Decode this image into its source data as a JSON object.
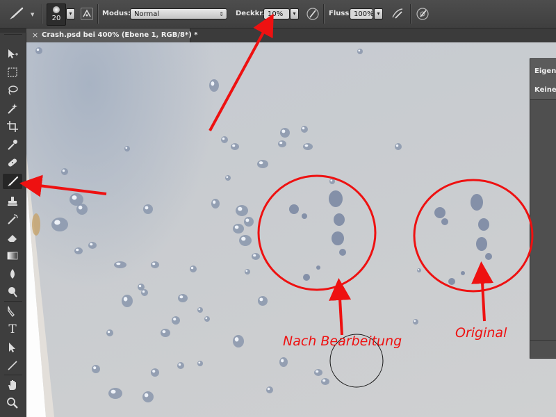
{
  "options_bar": {
    "brush_size": "20",
    "mode_label": "Modus:",
    "mode_value": "Normal",
    "opacity_label": "Deckkr.:",
    "opacity_value": "10%",
    "flow_label": "Fluss:",
    "flow_value": "100%"
  },
  "document_tab": {
    "close_glyph": "×",
    "title": "Crash.psd bei 400% (Ebene 1, RGB/8*) *"
  },
  "properties_panel": {
    "title": "Eigens",
    "content": "Keine"
  },
  "annotations": {
    "after_label": "Nach Bearbeitung",
    "original_label": "Original"
  },
  "colors": {
    "annotation_red": "#ee1111",
    "ui_dark": "#3e3e3e",
    "canvas_gray": "#c9ccd0"
  },
  "tools": [
    "move-tool-icon",
    "marquee-tool-icon",
    "lasso-tool-icon",
    "magic-wand-tool-icon",
    "crop-tool-icon",
    "eyedropper-tool-icon",
    "healing-brush-tool-icon",
    "brush-tool-icon",
    "clone-stamp-tool-icon",
    "history-brush-tool-icon",
    "eraser-tool-icon",
    "gradient-tool-icon",
    "blur-tool-icon",
    "dodge-tool-icon",
    "pen-tool-icon",
    "type-tool-icon",
    "path-selection-tool-icon",
    "line-tool-icon",
    "hand-tool-icon",
    "zoom-tool-icon"
  ]
}
